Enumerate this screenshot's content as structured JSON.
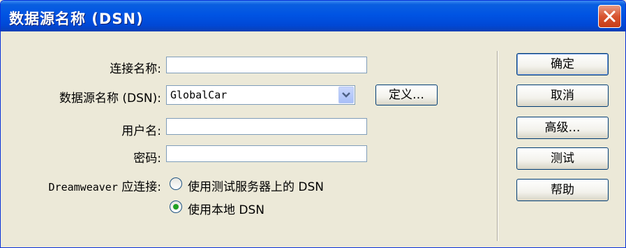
{
  "window": {
    "title": "数据源名称 (DSN)"
  },
  "form": {
    "connection_name_label": "连接名称:",
    "connection_name_value": "",
    "dsn_label": "数据源名称 (DSN):",
    "dsn_value": "GlobalCar",
    "define_button": "定义…",
    "username_label": "用户名:",
    "username_value": "",
    "password_label": "密码:",
    "password_value": "",
    "connect_label": "Dreamweaver 应连接:",
    "radio_server": "使用测试服务器上的 DSN",
    "radio_local": "使用本地 DSN",
    "radio_selected": "local"
  },
  "buttons": {
    "ok": "确定",
    "cancel": "取消",
    "advanced": "高级…",
    "test": "测试",
    "help": "帮助"
  },
  "colors": {
    "titlebar": "#0054e3",
    "close": "#d8542f",
    "dialog_bg": "#ece9d8",
    "radio_dot": "#21a121"
  }
}
